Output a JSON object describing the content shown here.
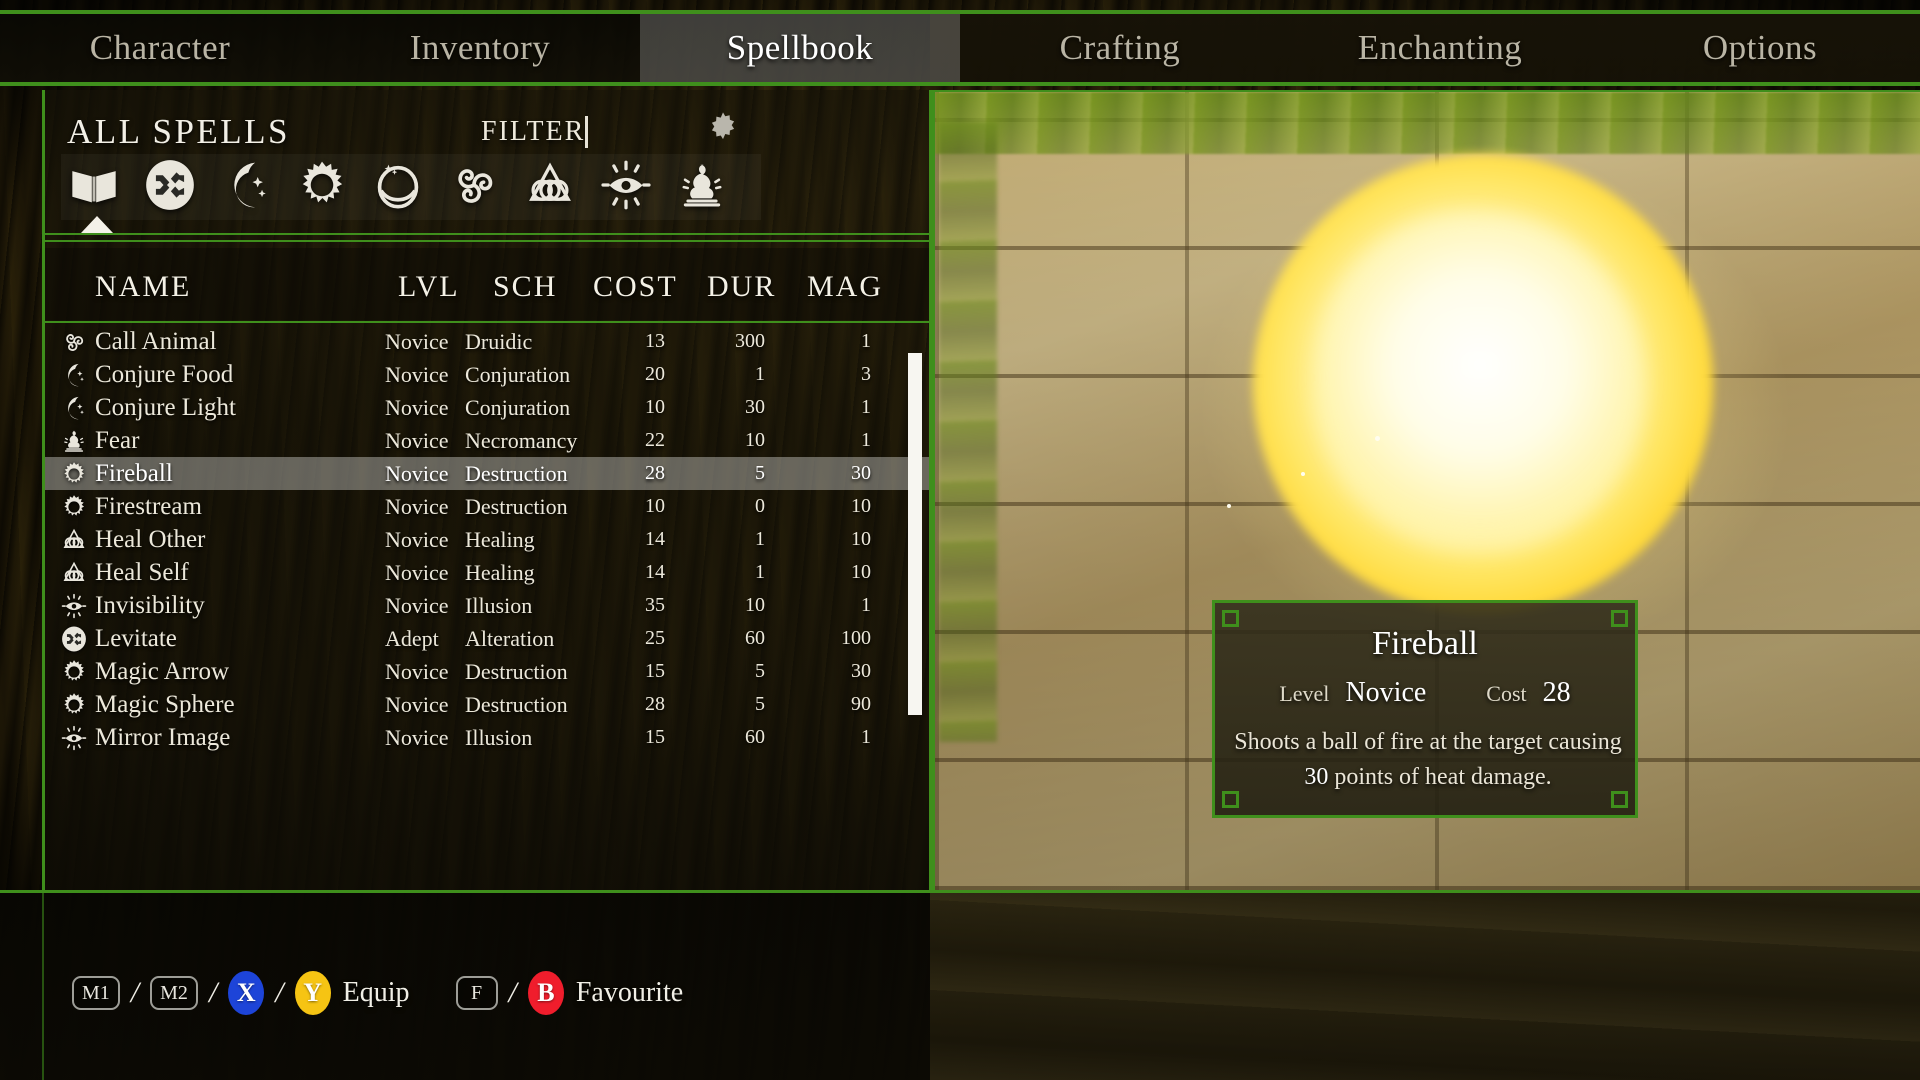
{
  "theme": {
    "accent_green": "#3f8f1c",
    "highlight_row": "#d7d7d2",
    "text_light": "#ece8da"
  },
  "tabs": [
    {
      "label": "Character",
      "active": false
    },
    {
      "label": "Inventory",
      "active": false
    },
    {
      "label": "Spellbook",
      "active": true
    },
    {
      "label": "Crafting",
      "active": false
    },
    {
      "label": "Enchanting",
      "active": false
    },
    {
      "label": "Options",
      "active": false
    }
  ],
  "left_panel": {
    "title": "ALL SPELLS",
    "filter_label": "FILTER",
    "filter_value": "",
    "filter_placeholder": "",
    "settings_icon": "gear-icon",
    "school_filters": [
      {
        "name": "all-spells",
        "icon": "book-icon",
        "selected": true
      },
      {
        "name": "alteration",
        "icon": "shuffle-arrows-icon",
        "selected": false
      },
      {
        "name": "conjuration",
        "icon": "crescent-moon-icon",
        "selected": false
      },
      {
        "name": "destruction",
        "icon": "flaming-sun-icon",
        "selected": false
      },
      {
        "name": "restoration",
        "icon": "orb-icon",
        "selected": false
      },
      {
        "name": "druidic",
        "icon": "triskelion-icon",
        "selected": false
      },
      {
        "name": "healing",
        "icon": "triquetra-icon",
        "selected": false
      },
      {
        "name": "illusion",
        "icon": "radiant-eye-icon",
        "selected": false
      },
      {
        "name": "necromancy",
        "icon": "statue-icon",
        "selected": false
      }
    ],
    "columns": [
      "NAME",
      "LVL",
      "SCH",
      "COST",
      "DUR",
      "MAG"
    ],
    "spells": [
      {
        "icon": "triskelion-icon",
        "name": "Call Animal",
        "lvl": "Novice",
        "sch": "Druidic",
        "cost": "13",
        "dur": "300",
        "mag": "1",
        "selected": false
      },
      {
        "icon": "crescent-moon-icon",
        "name": "Conjure Food",
        "lvl": "Novice",
        "sch": "Conjuration",
        "cost": "20",
        "dur": "1",
        "mag": "3",
        "selected": false
      },
      {
        "icon": "crescent-moon-icon",
        "name": "Conjure Light",
        "lvl": "Novice",
        "sch": "Conjuration",
        "cost": "10",
        "dur": "30",
        "mag": "1",
        "selected": false
      },
      {
        "icon": "statue-icon",
        "name": "Fear",
        "lvl": "Novice",
        "sch": "Necromancy",
        "cost": "22",
        "dur": "10",
        "mag": "1",
        "selected": false
      },
      {
        "icon": "flaming-sun-icon",
        "name": "Fireball",
        "lvl": "Novice",
        "sch": "Destruction",
        "cost": "28",
        "dur": "5",
        "mag": "30",
        "selected": true
      },
      {
        "icon": "flaming-sun-icon",
        "name": "Firestream",
        "lvl": "Novice",
        "sch": "Destruction",
        "cost": "10",
        "dur": "0",
        "mag": "10",
        "selected": false
      },
      {
        "icon": "triquetra-icon",
        "name": "Heal Other",
        "lvl": "Novice",
        "sch": "Healing",
        "cost": "14",
        "dur": "1",
        "mag": "10",
        "selected": false
      },
      {
        "icon": "triquetra-icon",
        "name": "Heal Self",
        "lvl": "Novice",
        "sch": "Healing",
        "cost": "14",
        "dur": "1",
        "mag": "10",
        "selected": false
      },
      {
        "icon": "radiant-eye-icon",
        "name": "Invisibility",
        "lvl": "Novice",
        "sch": "Illusion",
        "cost": "35",
        "dur": "10",
        "mag": "1",
        "selected": false
      },
      {
        "icon": "shuffle-arrows-icon",
        "name": "Levitate",
        "lvl": "Adept",
        "sch": "Alteration",
        "cost": "25",
        "dur": "60",
        "mag": "100",
        "selected": false
      },
      {
        "icon": "flaming-sun-icon",
        "name": "Magic Arrow",
        "lvl": "Novice",
        "sch": "Destruction",
        "cost": "15",
        "dur": "5",
        "mag": "30",
        "selected": false
      },
      {
        "icon": "flaming-sun-icon",
        "name": "Magic Sphere",
        "lvl": "Novice",
        "sch": "Destruction",
        "cost": "28",
        "dur": "5",
        "mag": "90",
        "selected": false
      },
      {
        "icon": "radiant-eye-icon",
        "name": "Mirror Image",
        "lvl": "Novice",
        "sch": "Illusion",
        "cost": "15",
        "dur": "60",
        "mag": "1",
        "selected": false
      }
    ]
  },
  "preview": {
    "effect": "fireball-orb"
  },
  "tooltip": {
    "title": "Fireball",
    "level_label": "Level",
    "level_value": "Novice",
    "cost_label": "Cost",
    "cost_value": "28",
    "description_line1": "Shoots a ball of fire at the target causing",
    "description_amount": "30",
    "description_line2": "points of heat damage."
  },
  "footer_hints": [
    {
      "type": "key",
      "label": "M1",
      "style": "outline"
    },
    {
      "type": "sep",
      "label": "/"
    },
    {
      "type": "key",
      "label": "M2",
      "style": "outline"
    },
    {
      "type": "sep",
      "label": "/"
    },
    {
      "type": "pad",
      "label": "X",
      "color": "#1d44d8"
    },
    {
      "type": "sep",
      "label": "/"
    },
    {
      "type": "pad",
      "label": "Y",
      "color": "#f6c413"
    },
    {
      "type": "text",
      "label": "Equip"
    },
    {
      "type": "gap",
      "label": ""
    },
    {
      "type": "key",
      "label": "F",
      "style": "outline"
    },
    {
      "type": "sep",
      "label": "/"
    },
    {
      "type": "pad",
      "label": "B",
      "color": "#f01d2c"
    },
    {
      "type": "text",
      "label": "Favourite"
    }
  ]
}
